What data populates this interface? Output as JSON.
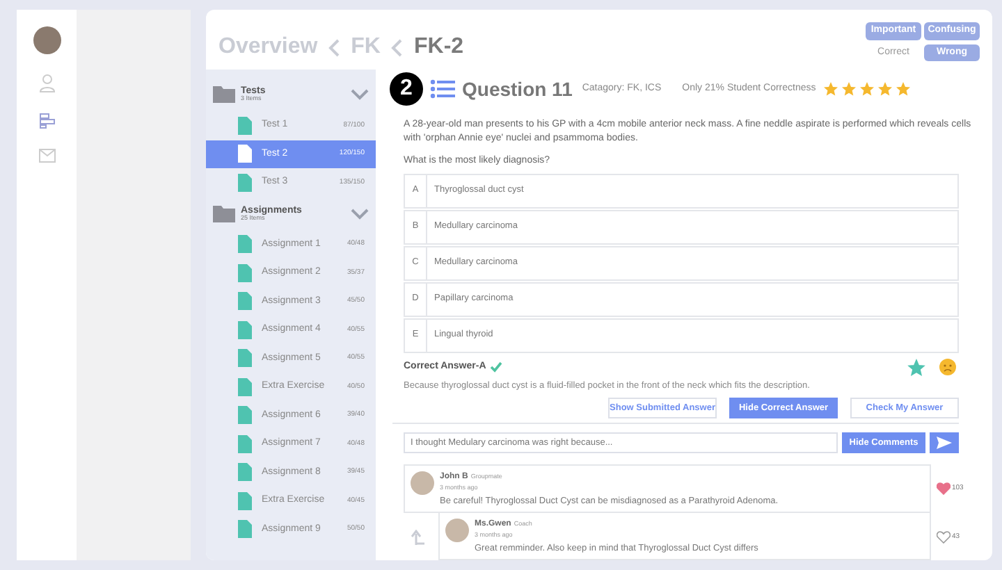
{
  "breadcrumb": [
    {
      "label": "Overview",
      "current": false
    },
    {
      "label": "FK",
      "current": false
    },
    {
      "label": "FK-2",
      "current": true
    }
  ],
  "tags": [
    {
      "label": "Important",
      "selected": true
    },
    {
      "label": "Confusing",
      "selected": true
    },
    {
      "label": "Correct",
      "selected": false
    },
    {
      "label": "Wrong",
      "selected": true
    }
  ],
  "folders": [
    {
      "name": "Tests",
      "count": "3 Items",
      "expanded": true,
      "items": [
        {
          "name": "Test 1",
          "score": "87/100",
          "selected": false
        },
        {
          "name": "Test 2",
          "score": "120/150",
          "selected": true
        },
        {
          "name": "Test 3",
          "score": "135/150",
          "selected": false
        }
      ]
    },
    {
      "name": "Assignments",
      "count": "25 Items",
      "expanded": true,
      "items": [
        {
          "name": "Assignment 1",
          "score": "40/48",
          "selected": false
        },
        {
          "name": "Assignment 2",
          "score": "35/37",
          "selected": false
        },
        {
          "name": "Assignment 3",
          "score": "45/50",
          "selected": false
        },
        {
          "name": "Assignment 4",
          "score": "40/55",
          "selected": false
        },
        {
          "name": "Assignment 5",
          "score": "40/55",
          "selected": false
        },
        {
          "name": "Extra Exercise",
          "score": "40/50",
          "selected": false
        },
        {
          "name": "Assignment 6",
          "score": "39/40",
          "selected": false
        },
        {
          "name": "Assignment 7",
          "score": "40/48",
          "selected": false
        },
        {
          "name": "Assignment 8",
          "score": "39/45",
          "selected": false
        },
        {
          "name": "Extra Exercise",
          "score": "40/45",
          "selected": false
        },
        {
          "name": "Assignment 9",
          "score": "50/50",
          "selected": false
        }
      ]
    }
  ],
  "question": {
    "step": "2",
    "title": "Question 11",
    "category": "Catagory: FK, ICS",
    "correctness": "Only 21% Student Correctness",
    "stars": 5,
    "stem": "A 28-year-old man presents to his GP with a 4cm mobile anterior neck mass. A fine neddle aspirate is performed which reveals cells with 'orphan Annie eye' nuclei and psammoma bodies.",
    "prompt": "What is the most likely diagnosis?",
    "options": [
      {
        "letter": "A",
        "text": "Thyroglossal duct cyst"
      },
      {
        "letter": "B",
        "text": "Medullary carcinoma"
      },
      {
        "letter": "C",
        "text": "Medullary carcinoma"
      },
      {
        "letter": "D",
        "text": "Papillary carcinoma"
      },
      {
        "letter": "E",
        "text": "Lingual thyroid"
      }
    ],
    "correct_answer": "Correct Answer-A",
    "favorited": true,
    "explanation": "Because thyroglossal duct cyst is a fluid-filled pocket in the front of the neck which fits the description."
  },
  "buttons": [
    {
      "label": "Show Submitted Answer",
      "selected": false
    },
    {
      "label": "Hide Correct Answer",
      "selected": true
    },
    {
      "label": "Check My Answer",
      "selected": false
    }
  ],
  "comment_input": {
    "value": "I thought Medulary carcinoma was right because..."
  },
  "hide_comments": "Hide Comments",
  "comments": [
    {
      "author": "John B",
      "role": "Groupmate",
      "time": "3 months ago",
      "text": "Be careful! Thyroglossal Duct Cyst can be misdiagnosed as a Parathyroid Adenoma.",
      "liked": true,
      "likes": "103",
      "reply": false
    },
    {
      "author": "Ms.Gwen",
      "role": "Coach",
      "time": "3 months ago",
      "text": "Great remminder. Also keep in mind that Thyroglossal Duct Cyst differs",
      "liked": false,
      "likes": "43",
      "reply": true
    }
  ]
}
